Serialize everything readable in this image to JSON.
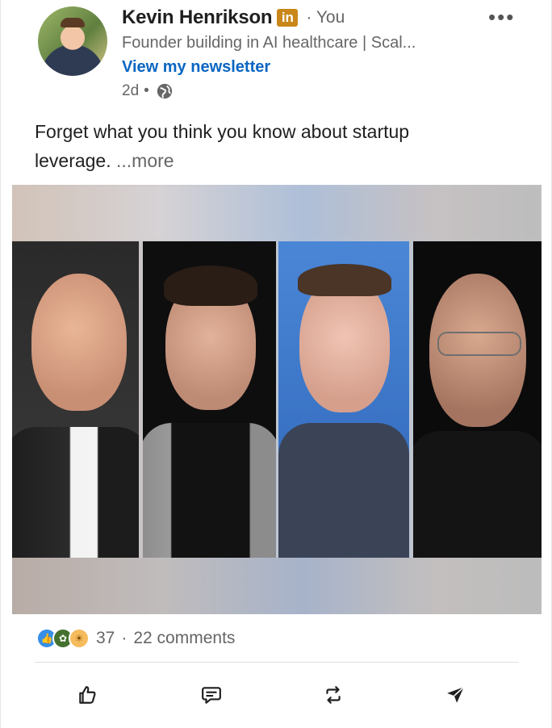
{
  "author": {
    "name": "Kevin Henrikson",
    "badge": "in",
    "relation": "You",
    "headline": "Founder building in AI healthcare | Scal...",
    "newsletter_link": "View my newsletter",
    "time": "2d",
    "visibility_icon": "globe-icon"
  },
  "overflow_label": "•••",
  "post": {
    "text": "Forget what you think you know about startup leverage.",
    "more_label": "...more"
  },
  "stats": {
    "reaction_icons": [
      "like-icon",
      "celebrate-icon",
      "insightful-icon"
    ],
    "reaction_count": "37",
    "separator": "·",
    "comments": "22 comments"
  },
  "actions": [
    {
      "name": "like",
      "icon": "thumbs-up-icon"
    },
    {
      "name": "comment",
      "icon": "comment-icon"
    },
    {
      "name": "repost",
      "icon": "repost-icon"
    },
    {
      "name": "send",
      "icon": "send-icon"
    }
  ],
  "colors": {
    "link": "#0a66c2",
    "badge": "#c9871a",
    "like": "#378fe9",
    "celebrate": "#44712e",
    "insightful": "#f5bb5c"
  }
}
